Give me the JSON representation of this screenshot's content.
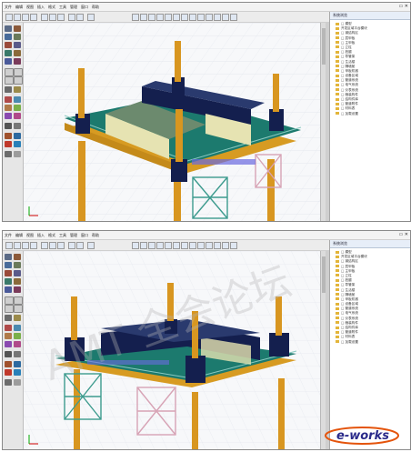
{
  "windows": [
    {
      "id": "top",
      "menu": [
        "文件",
        "编辑",
        "视图",
        "插入",
        "格式",
        "工具",
        "管理",
        "窗口",
        "帮助"
      ],
      "panel_title": "系统浏览",
      "tree": [
        "□ 模型",
        "开发区域平台模块",
        "□ 钢结构区",
        "□ 层甲板",
        "□ 主甲板",
        "□ 立柱",
        "□ 桩腿",
        "□ 导管架",
        "□ 生活楼",
        "□ 隔墙舱",
        "□ 甲板机械",
        "□ 设备区域",
        "□ 管道系统",
        "□ 电气系统",
        "□ 仪表系统",
        "□ 舾装构件",
        "□ 结构件库",
        "□ 管道附件",
        "□ 材料表",
        "□ 加载设置"
      ]
    },
    {
      "id": "bottom",
      "menu": [
        "文件",
        "编辑",
        "视图",
        "插入",
        "格式",
        "工具",
        "管理",
        "窗口",
        "帮助"
      ],
      "panel_title": "系统浏览",
      "tree": [
        "□ 模型",
        "开发区域平台模块",
        "□ 钢结构区",
        "□ 层甲板",
        "□ 主甲板",
        "□ 立柱",
        "□ 桩腿",
        "□ 导管架",
        "□ 生活楼",
        "□ 隔墙舱",
        "□ 甲板机械",
        "□ 设备区域",
        "□ 管道系统",
        "□ 电气系统",
        "□ 仪表系统",
        "□ 舾装构件",
        "□ 结构件库",
        "□ 管道附件",
        "□ 材料表",
        "□ 加载设置"
      ]
    }
  ],
  "watermark": "AMT 全会论坛",
  "logo": {
    "text": "e-works",
    "color": "#2a2a8a",
    "accent": "#e4540c"
  },
  "colors": {
    "deck": "#1c7a6e",
    "deck_under": "#d79b22",
    "leg": "#d89620",
    "module": "#141f4e",
    "house_wall": "#e6e3b2",
    "roof": "#6c8a6e",
    "truss": "#d7a3b5",
    "truss_green": "#3d9b8e"
  }
}
